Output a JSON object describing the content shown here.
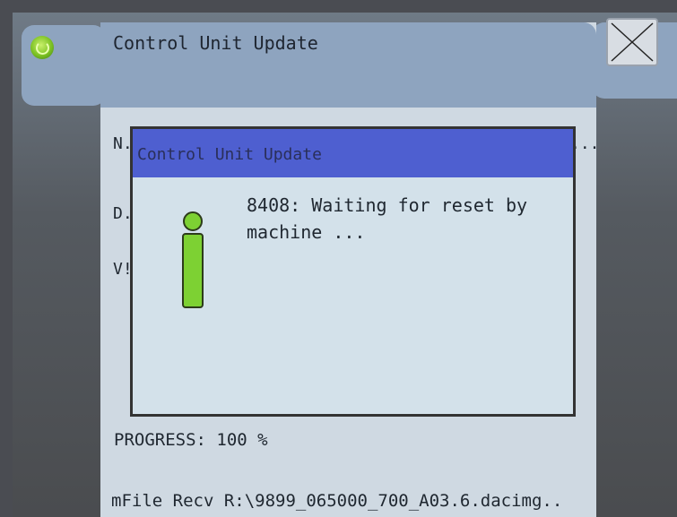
{
  "window": {
    "title": "Control Unit Update",
    "close_icon": "close-x-icon",
    "app_icon": "control-unit-icon"
  },
  "background_rows": {
    "n_label": "N.",
    "d_label": "D.",
    "v_label": "V!",
    "overflow_dots": "..."
  },
  "dialog": {
    "title": "Control Unit Update",
    "icon": "info-icon",
    "message": "8408: Waiting for reset by machine ..."
  },
  "status": {
    "progress_label": "PROGRESS: 100 %",
    "progress_value": 100,
    "file_recv": "mFile Recv R:\\9899_065000_700_A03.6.dacimg.."
  },
  "colors": {
    "dialog_title_bar": "#4e5fd0",
    "panel": "#cfd9e2",
    "title_bar": "#8ea4bf",
    "info_icon": "#7dd133"
  }
}
